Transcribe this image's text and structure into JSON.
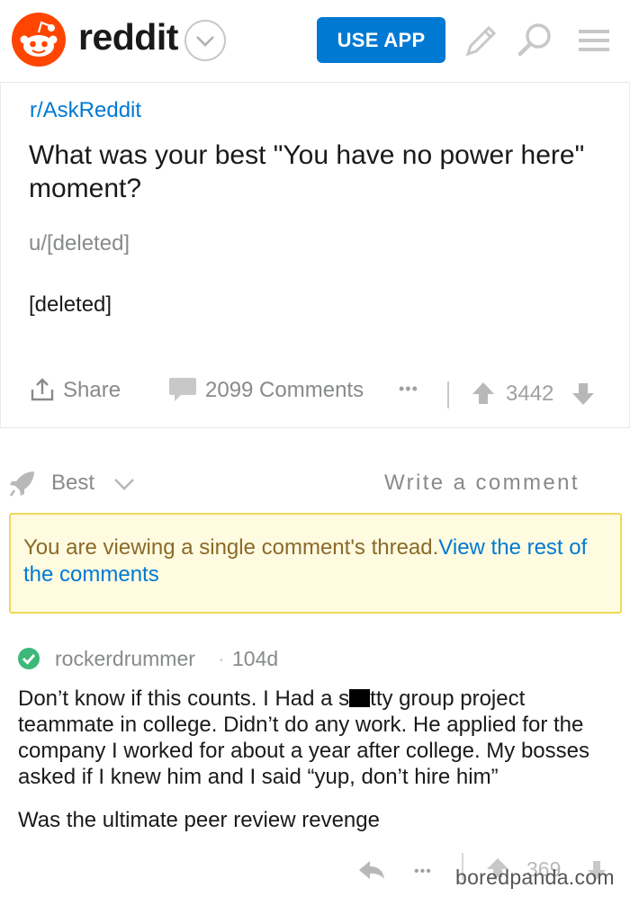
{
  "header": {
    "logo_word": "reddit",
    "use_app_label": "USE APP",
    "brand_color": "#ff4500",
    "accent_color": "#0079d3",
    "icons": [
      "snoo-logo-icon",
      "chevron-down-icon",
      "pencil-icon",
      "search-icon",
      "hamburger-menu-icon"
    ]
  },
  "post": {
    "subreddit": "r/AskReddit",
    "title": "What was your best \"You have no power here\" moment?",
    "author": "u/[deleted]",
    "body": "[deleted]",
    "share_label": "Share",
    "comments_label": "2099 Comments",
    "more_label": "•••",
    "score": "3442"
  },
  "sort": {
    "label": "Best",
    "write_comment_label": "Write a comment"
  },
  "notice": {
    "text": "You are viewing a single comment's thread.",
    "link_text": "View the rest of the comments"
  },
  "comment": {
    "author": "rockerdrummer",
    "age": "104d",
    "body_line1_start": "Don’t know if this counts. I Had a s",
    "body_line1_end": "tty group project teammate in college. Didn’t do any work. He applied for the company I worked for about a year after college. My bosses asked if I knew him and I said “yup, don’t hire him”",
    "body_paragraph2": "Was the ultimate peer review revenge",
    "more_label": "•••",
    "score": "369"
  },
  "watermark": "boredpanda.com"
}
